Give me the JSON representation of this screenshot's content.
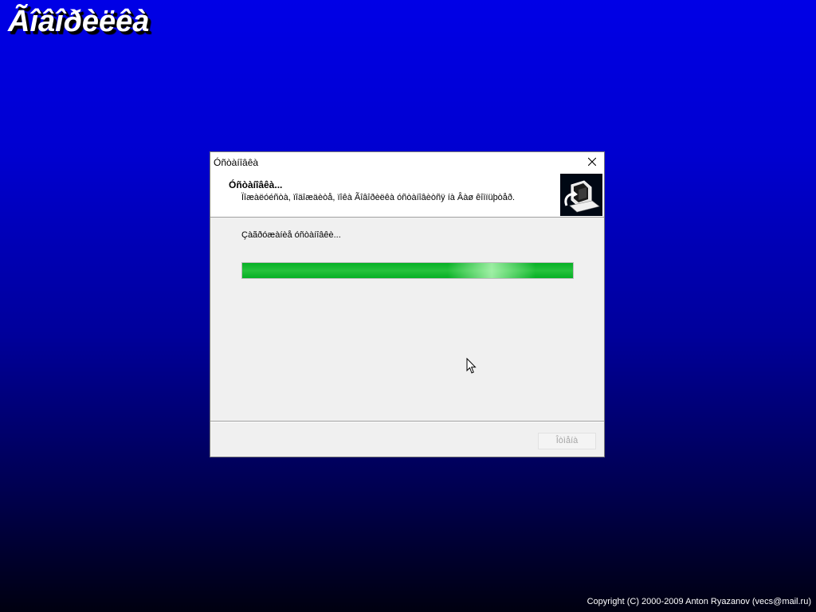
{
  "desktop": {
    "app_title": "Ãîâîðèëêà",
    "copyright": "Copyright (C) 2000-2009 Anton Ryazanov (vecs@mail.ru)",
    "background_colors": [
      "#0000e6",
      "#000010"
    ]
  },
  "dialog": {
    "title": "Óñòàíîâêà",
    "close_icon": "close-icon",
    "header": {
      "title": "Óñòàíîâêà...",
      "subtitle": "Ïîæàëóéñòà, ïîäîæäèòå, ïîêà Ãîâîðèëêà óñòàíîâèòñÿ íà Âàø êîìïüþòåð.",
      "logo_icon": "installer-computer-icon"
    },
    "status_text": "Çàãðóæàíèå óñòàíîâêè...",
    "progress": {
      "fraction": 1.0,
      "marquee_position": 0.75,
      "color": "#06b025"
    },
    "buttons": {
      "next_label": "Îòìåíà",
      "next_enabled": false
    }
  }
}
